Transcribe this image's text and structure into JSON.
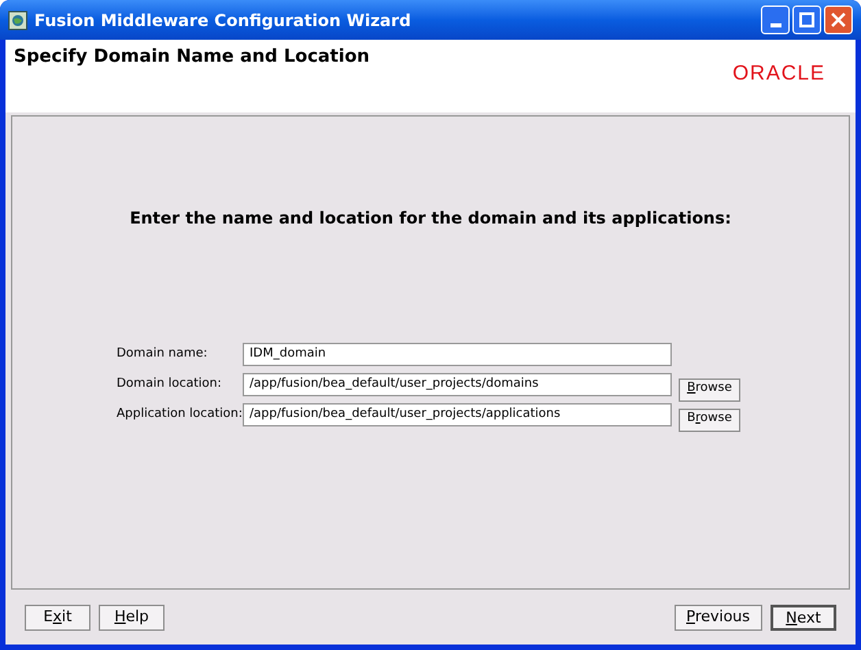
{
  "window": {
    "title": "Fusion Middleware Configuration Wizard"
  },
  "header": {
    "title": "Specify Domain Name and Location",
    "logo": "ORACLE"
  },
  "content": {
    "heading": "Enter the name and location for the domain and its applications:",
    "fields": [
      {
        "label": "Domain name:",
        "value": "IDM_domain"
      },
      {
        "label": "Domain location:",
        "value": "/app/fusion/bea_default/user_projects/domains",
        "browse": {
          "underlined": "B",
          "after": "rowse"
        }
      },
      {
        "label": "Application location:",
        "value": "/app/fusion/bea_default/user_projects/applications",
        "browse": {
          "before": "B",
          "underlined": "r",
          "after": "owse"
        }
      }
    ]
  },
  "footer": {
    "left_buttons": [
      {
        "before": "E",
        "underlined": "x",
        "after": "it",
        "default": false
      },
      {
        "underlined": "H",
        "after": "elp",
        "default": false
      }
    ],
    "right_buttons": [
      {
        "underlined": "P",
        "after": "revious",
        "default": false
      },
      {
        "underlined": "N",
        "after": "ext",
        "default": true
      }
    ]
  }
}
